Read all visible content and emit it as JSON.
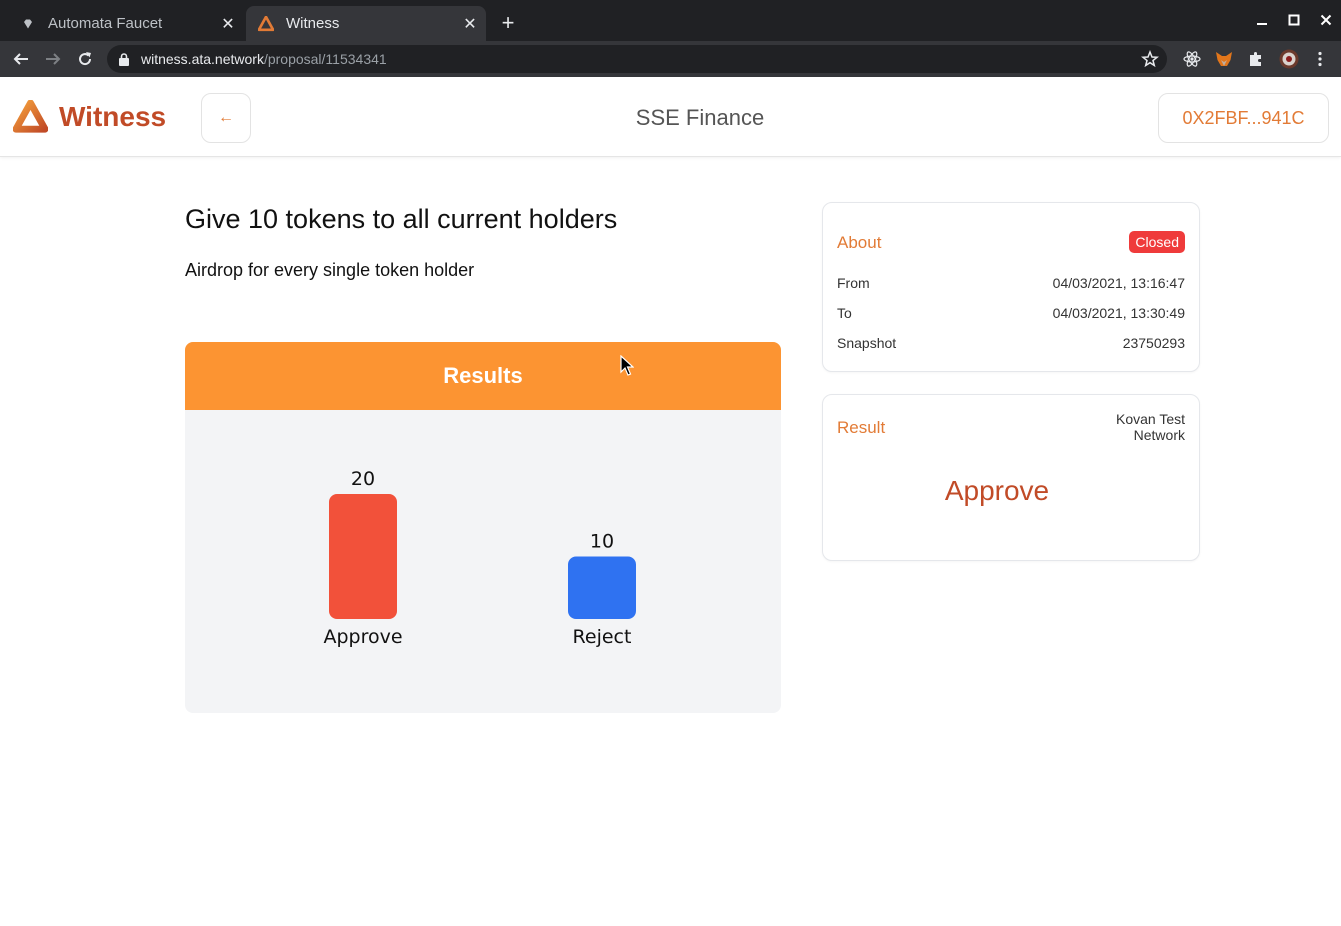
{
  "browser": {
    "tabs": [
      {
        "title": "Automata Faucet",
        "active": false
      },
      {
        "title": "Witness",
        "active": true
      }
    ],
    "url_host": "witness.ata.network",
    "url_path": "/proposal/11534341"
  },
  "header": {
    "brand": "Witness",
    "back_icon": "←",
    "space_name": "SSE Finance",
    "wallet": "0X2FBF...941C"
  },
  "proposal": {
    "title": "Give 10 tokens to all current holders",
    "body": "Airdrop for every single token holder"
  },
  "results": {
    "heading": "Results"
  },
  "chart_data": {
    "type": "bar",
    "categories": [
      "Approve",
      "Reject"
    ],
    "values": [
      20,
      10
    ],
    "colors": [
      "#f2513a",
      "#2f72f1"
    ],
    "title": "",
    "xlabel": "",
    "ylabel": "",
    "ylim": [
      0,
      20
    ]
  },
  "about": {
    "title": "About",
    "status": "Closed",
    "rows": [
      {
        "label": "From",
        "value": "04/03/2021, 13:16:47"
      },
      {
        "label": "To",
        "value": "04/03/2021, 13:30:49"
      },
      {
        "label": "Snapshot",
        "value": "23750293"
      }
    ]
  },
  "result": {
    "title": "Result",
    "network": "Kovan Test Network",
    "winner": "Approve"
  },
  "colors": {
    "brand": "#c14b27",
    "accent": "#e27b36",
    "results_header": "#fc9432",
    "closed_badge": "#ef3b3b"
  }
}
